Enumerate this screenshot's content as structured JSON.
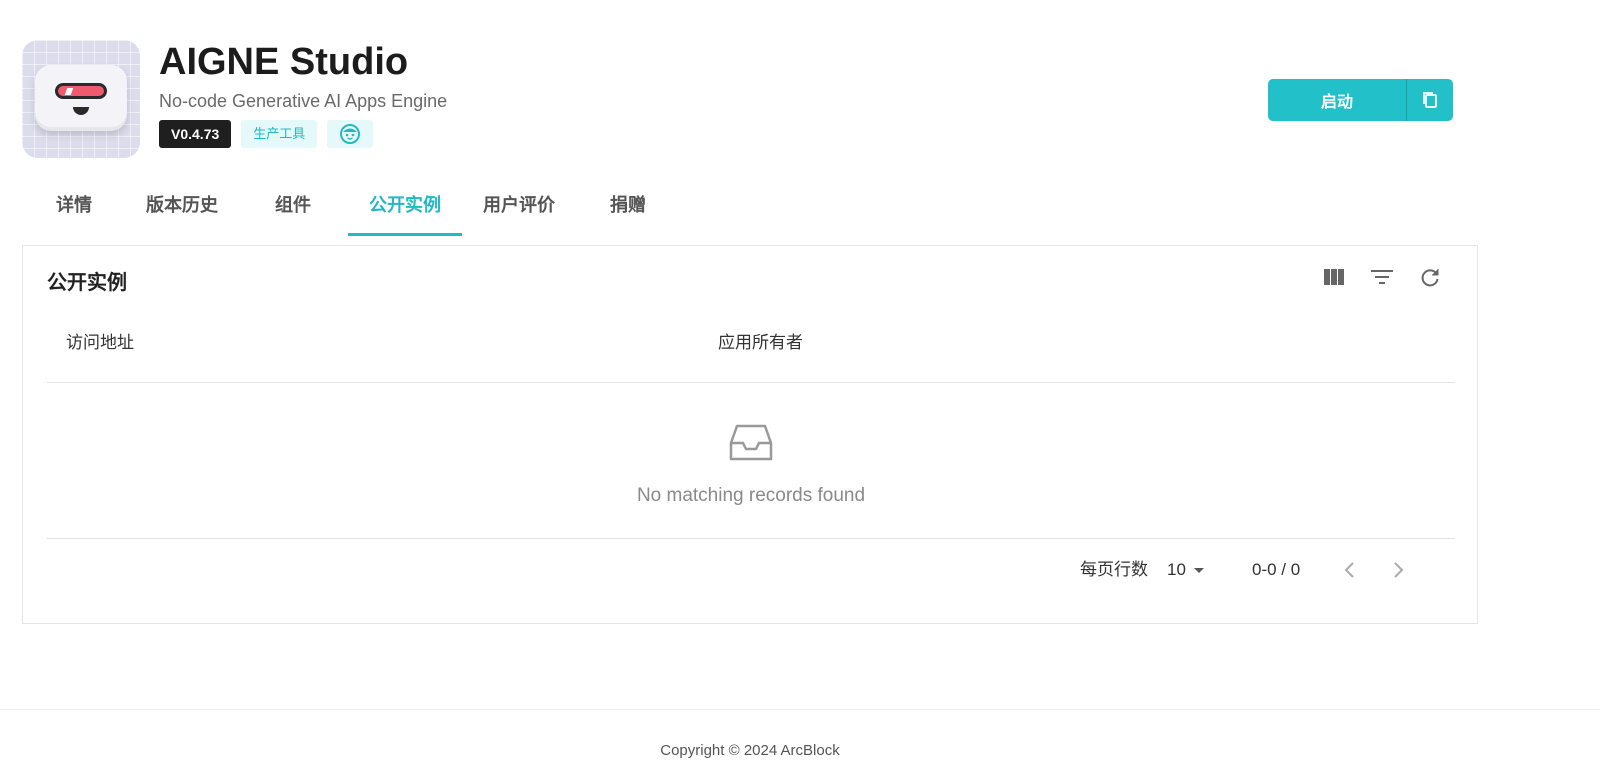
{
  "app": {
    "name": "AIGNE Studio",
    "subtitle": "No-code Generative AI Apps Engine",
    "version": "V0.4.73",
    "category": "生产工具",
    "icon": "robot-app-icon",
    "avatar_icon": "user-face-icon"
  },
  "actions": {
    "launch_label": "启动",
    "copy_icon": "copy-icon"
  },
  "tabs": [
    {
      "label": "详情",
      "active": false
    },
    {
      "label": "版本历史",
      "active": false
    },
    {
      "label": "组件",
      "active": false
    },
    {
      "label": "公开实例",
      "active": true
    },
    {
      "label": "用户评价",
      "active": false
    },
    {
      "label": "捐赠",
      "active": false
    }
  ],
  "panel": {
    "title": "公开实例",
    "tools": [
      "view-columns-icon",
      "filter-icon",
      "refresh-icon"
    ],
    "columns": [
      "访问地址",
      "应用所有者"
    ],
    "empty_text": "No matching records found",
    "empty_icon": "inbox-icon"
  },
  "pagination": {
    "rows_per_page_label": "每页行数",
    "rows_per_page": "10",
    "range": "0-0 / 0"
  },
  "footer": {
    "copyright": "Copyright © 2024 ArcBlock"
  },
  "colors": {
    "accent": "#22c0c9",
    "version_badge": "#1f1f1f",
    "category_bg": "#e6f9fa"
  }
}
